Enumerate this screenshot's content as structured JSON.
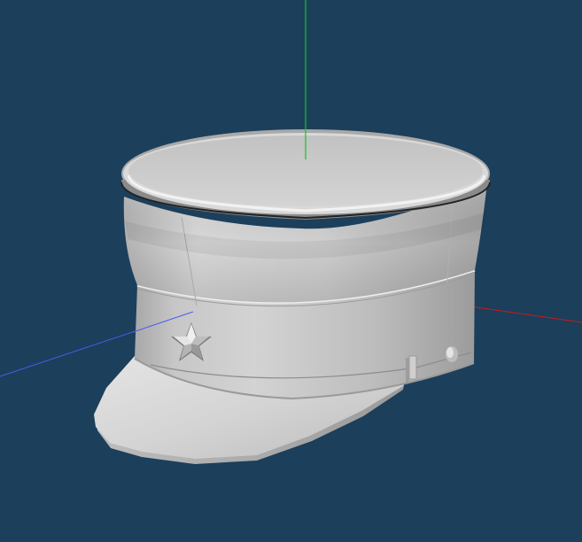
{
  "viewport": {
    "background": "#1c3f5b"
  },
  "axes": {
    "x": {
      "color": "#d01818"
    },
    "y": {
      "color": "#13c22a"
    },
    "z": {
      "color": "#4a5cf0"
    }
  },
  "model": {
    "name": "",
    "base_color": "#c9c9c9",
    "star_icon": "star-icon",
    "button_icon": "button-icon"
  }
}
